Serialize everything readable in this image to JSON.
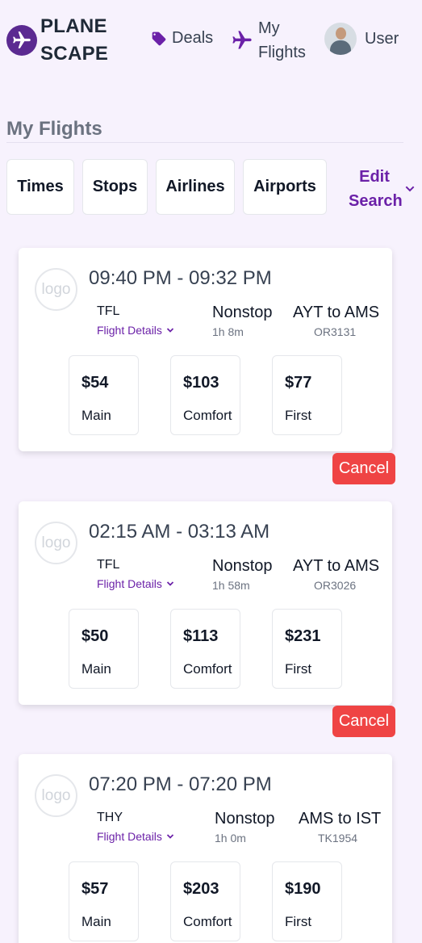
{
  "brand": {
    "line1": "PLANE",
    "line2": "SCAPE",
    "brand_color": "#5b2a91"
  },
  "nav": {
    "deals": "Deals",
    "my_flights_1": "My",
    "my_flights_2": "Flights",
    "user": "User"
  },
  "page": {
    "title": "My Flights"
  },
  "filters": [
    "Times",
    "Stops",
    "Airlines",
    "Airports"
  ],
  "edit_search": {
    "line1": "Edit",
    "line2": "Search"
  },
  "logo_text": "logo",
  "details_label": "Flight Details",
  "cancel_label": "Cancel",
  "flights": [
    {
      "times": "09:40 PM - 09:32 PM",
      "airline": "TFL",
      "stops": "Nonstop",
      "duration": "1h 8m",
      "route": "AYT to AMS",
      "flight_no": "OR3131",
      "prices": [
        {
          "amount": "$54",
          "class": "Main"
        },
        {
          "amount": "$103",
          "class": "Comfort"
        },
        {
          "amount": "$77",
          "class": "First"
        }
      ]
    },
    {
      "times": "02:15 AM - 03:13 AM",
      "airline": "TFL",
      "stops": "Nonstop",
      "duration": "1h 58m",
      "route": "AYT to AMS",
      "flight_no": "OR3026",
      "prices": [
        {
          "amount": "$50",
          "class": "Main"
        },
        {
          "amount": "$113",
          "class": "Comfort"
        },
        {
          "amount": "$231",
          "class": "First"
        }
      ]
    },
    {
      "times": "07:20 PM - 07:20 PM",
      "airline": "THY",
      "stops": "Nonstop",
      "duration": "1h 0m",
      "route": "AMS to IST",
      "flight_no": "TK1954",
      "prices": [
        {
          "amount": "$57",
          "class": "Main"
        },
        {
          "amount": "$203",
          "class": "Comfort"
        },
        {
          "amount": "$190",
          "class": "First"
        }
      ]
    }
  ],
  "colors": {
    "accent": "#6b21a8",
    "cancel": "#ef4444",
    "background": "#f7f2fd"
  }
}
